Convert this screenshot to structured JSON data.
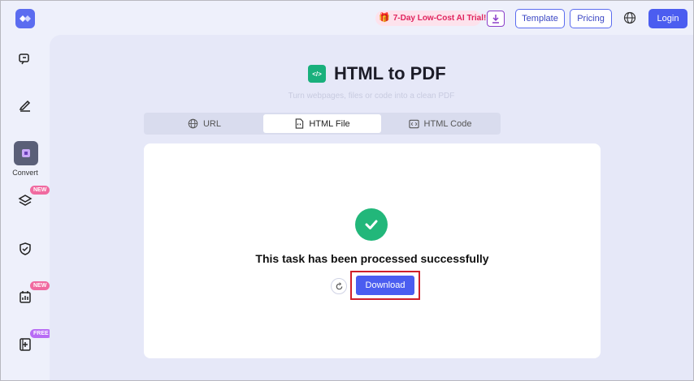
{
  "header": {
    "promo_label": "7-Day Low-Cost AI Trial!",
    "template_label": "Template",
    "pricing_label": "Pricing",
    "login_label": "Login"
  },
  "sidebar": {
    "items": [
      {
        "icon": "chat-icon"
      },
      {
        "icon": "edit-icon"
      },
      {
        "icon": "convert-icon",
        "label": "Convert",
        "active": true
      },
      {
        "icon": "layers-icon",
        "badge": "NEW"
      },
      {
        "icon": "shield-icon"
      },
      {
        "icon": "chart-icon",
        "badge": "NEW"
      },
      {
        "icon": "add-page-icon",
        "badge": "FREE"
      }
    ]
  },
  "main": {
    "title": "HTML to PDF",
    "subtitle": "Turn webpages, files or code into a clean PDF",
    "tabs": [
      {
        "label": "URL",
        "icon": "globe-icon"
      },
      {
        "label": "HTML File",
        "icon": "file-icon",
        "active": true
      },
      {
        "label": "HTML Code",
        "icon": "code-icon"
      }
    ],
    "message": "This task has been processed successfully",
    "download_label": "Download"
  },
  "colors": {
    "accent": "#4b5df0",
    "success": "#22b77a",
    "highlight": "#d0202a",
    "promo": "#e0245e"
  }
}
